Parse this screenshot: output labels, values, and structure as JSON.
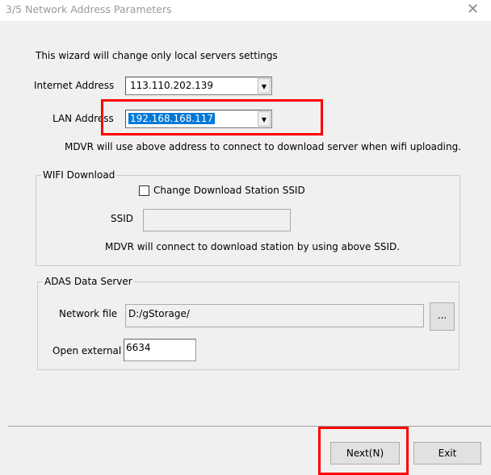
{
  "window": {
    "title": "3/5  Network Address Parameters",
    "close_icon": "close-icon"
  },
  "intro": "This wizard will change only local servers settings",
  "internet": {
    "label": "Internet Address",
    "value": "113.110.202.139"
  },
  "lan": {
    "label": "LAN Address",
    "value": "192.168.168.117"
  },
  "lan_note": "MDVR will use above address to connect to download server when wifi uploading.",
  "wifi": {
    "legend": "WIFI Download",
    "checkbox_label": "Change Download Station SSID",
    "checked": false,
    "ssid_label": "SSID",
    "ssid_value": "",
    "note": "MDVR will connect to download station by using above SSID."
  },
  "adas": {
    "legend": "ADAS Data Server",
    "network_label": "Network file",
    "network_value": "D:/gStorage/",
    "browse_label": "...",
    "port_label": "Open external",
    "port_value": "6634"
  },
  "buttons": {
    "next": "Next(N)",
    "exit": "Exit"
  },
  "colors": {
    "highlight_box": "#ff0000",
    "selection": "#0078d7"
  }
}
